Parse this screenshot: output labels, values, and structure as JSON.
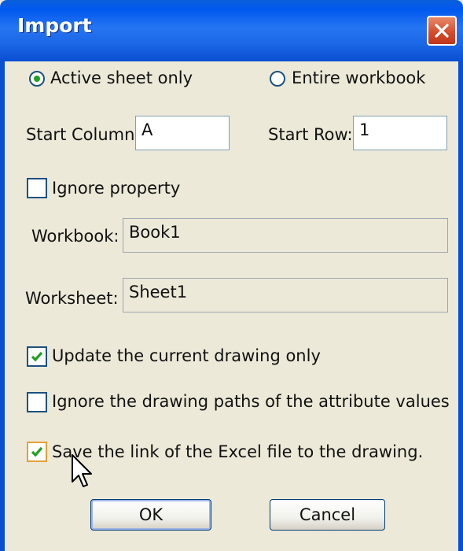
{
  "dialog": {
    "title": "Import"
  },
  "options": {
    "active_sheet_label": "Active sheet only",
    "entire_workbook_label": "Entire workbook",
    "selected": "active_sheet"
  },
  "start": {
    "column_label": "Start Column:",
    "column_value": "A",
    "row_label": "Start Row:",
    "row_value": "1"
  },
  "ignore_property": {
    "label": "Ignore property",
    "checked": false
  },
  "workbook": {
    "label": "Workbook:",
    "value": "Book1"
  },
  "worksheet": {
    "label": "Worksheet:",
    "value": "Sheet1"
  },
  "update_current": {
    "label": "Update the current drawing only",
    "checked": true
  },
  "ignore_paths": {
    "label": "Ignore the drawing paths of the attribute values",
    "checked": false
  },
  "save_link": {
    "label": "Save the link of the Excel file to the drawing.",
    "checked": true
  },
  "buttons": {
    "ok": "OK",
    "cancel": "Cancel"
  },
  "colors": {
    "titlebar": "#0058ee",
    "dialog_bg": "#ece9d8",
    "check_green": "#21a121",
    "close_red": "#d2492a"
  }
}
